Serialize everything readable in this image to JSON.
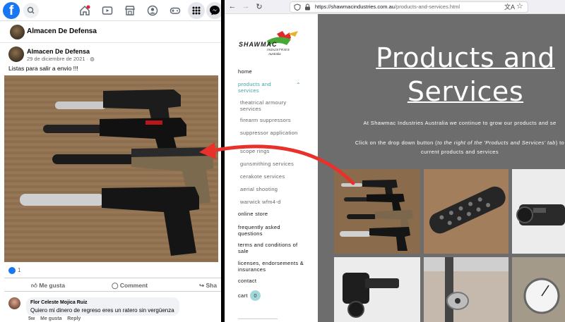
{
  "facebook": {
    "logo": "f",
    "page_name": "Almacen De Defensa",
    "post": {
      "author": "Almacen De Defensa",
      "date": "29 de diciembre de 2021 ·",
      "caption": "Listas para salir a envio !!!",
      "likes": "1"
    },
    "actions": {
      "like": "Me gusta",
      "comment": "Comment",
      "share": "Sha"
    },
    "comment": {
      "author": "Flor Celeste Mojica Ruiz",
      "text": "Quiero mi dinero de regreso eres un ratero sin vergüenza",
      "age": "5w",
      "like": "Me gusta",
      "reply": "Reply"
    },
    "icons": [
      "search-icon",
      "home-icon",
      "video-icon",
      "marketplace-icon",
      "groups-icon",
      "gaming-icon",
      "menu-grid-icon",
      "messenger-icon"
    ]
  },
  "browser": {
    "url_host": "https://shawmacindustries.com.au",
    "url_path": "/products-and-services.html",
    "icons": [
      "back-icon",
      "forward-icon",
      "reload-icon",
      "shield-icon",
      "lock-icon",
      "translate-icon",
      "star-icon"
    ]
  },
  "site": {
    "logo": {
      "line1": "SHAWMAC",
      "line2": "INDUSTRIES",
      "line3": "Australia"
    },
    "nav": {
      "home": "home",
      "products": "products and services",
      "sub": [
        "theatrical armoury services",
        "firearm suppressors",
        "suppressor application",
        "scope rings",
        "gunsmithing services",
        "cerakote services",
        "aerial shooting",
        "warwick wfm4-d"
      ],
      "online_store": "online store",
      "faq": "frequently asked questions",
      "terms": "terms and conditions of sale",
      "licenses": "licenses, endorsements & insurances",
      "contact": "contact",
      "cart": "cart",
      "cart_count": "0"
    },
    "main": {
      "title_line1": "Products and",
      "title_line2": "Services",
      "intro": "At Shawmac Industries Australia we continue to grow our products and se",
      "click_pre": "Click on the drop down button (",
      "click_em": "to the right of the 'Products and Services' tab",
      "click_post": ") to",
      "click_line2": "current products and services"
    }
  },
  "colors": {
    "facebook_blue": "#1877f2",
    "site_accent": "#3ca2a8",
    "site_main_bg": "#6d6d6d",
    "arrow": "#e8312b"
  }
}
